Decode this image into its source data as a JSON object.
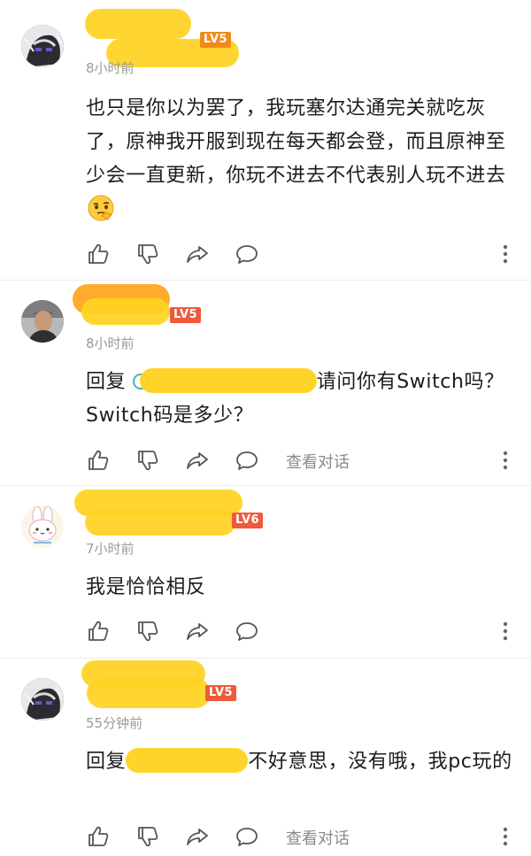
{
  "comments": [
    {
      "level": "LV5",
      "time": "8小时前",
      "text": "也只是你以为罢了，我玩塞尔达通完关就吃灰了，原神我开服到现在每天都会登，而且原神至少会一直更新，你玩不进去不代表别人玩不进去",
      "emoji": "thinking-face-icon"
    },
    {
      "level": "LV5",
      "time": "8小时前",
      "reply_prefix": "回复",
      "text_after": "请问你有Switch吗？Switch码是多少？",
      "view_replies": "查看对话"
    },
    {
      "level": "LV6",
      "time": "7小时前",
      "text": "我是恰恰相反"
    },
    {
      "level": "LV5",
      "time": "55分钟前",
      "reply_prefix": "回复",
      "text_after": "不好意思，没有哦，我pc玩的",
      "view_replies": "查看对话"
    }
  ],
  "colors": {
    "level_orange": "#f28a1a",
    "level_red": "#ef5a3c",
    "redaction": "#ffd21f"
  }
}
